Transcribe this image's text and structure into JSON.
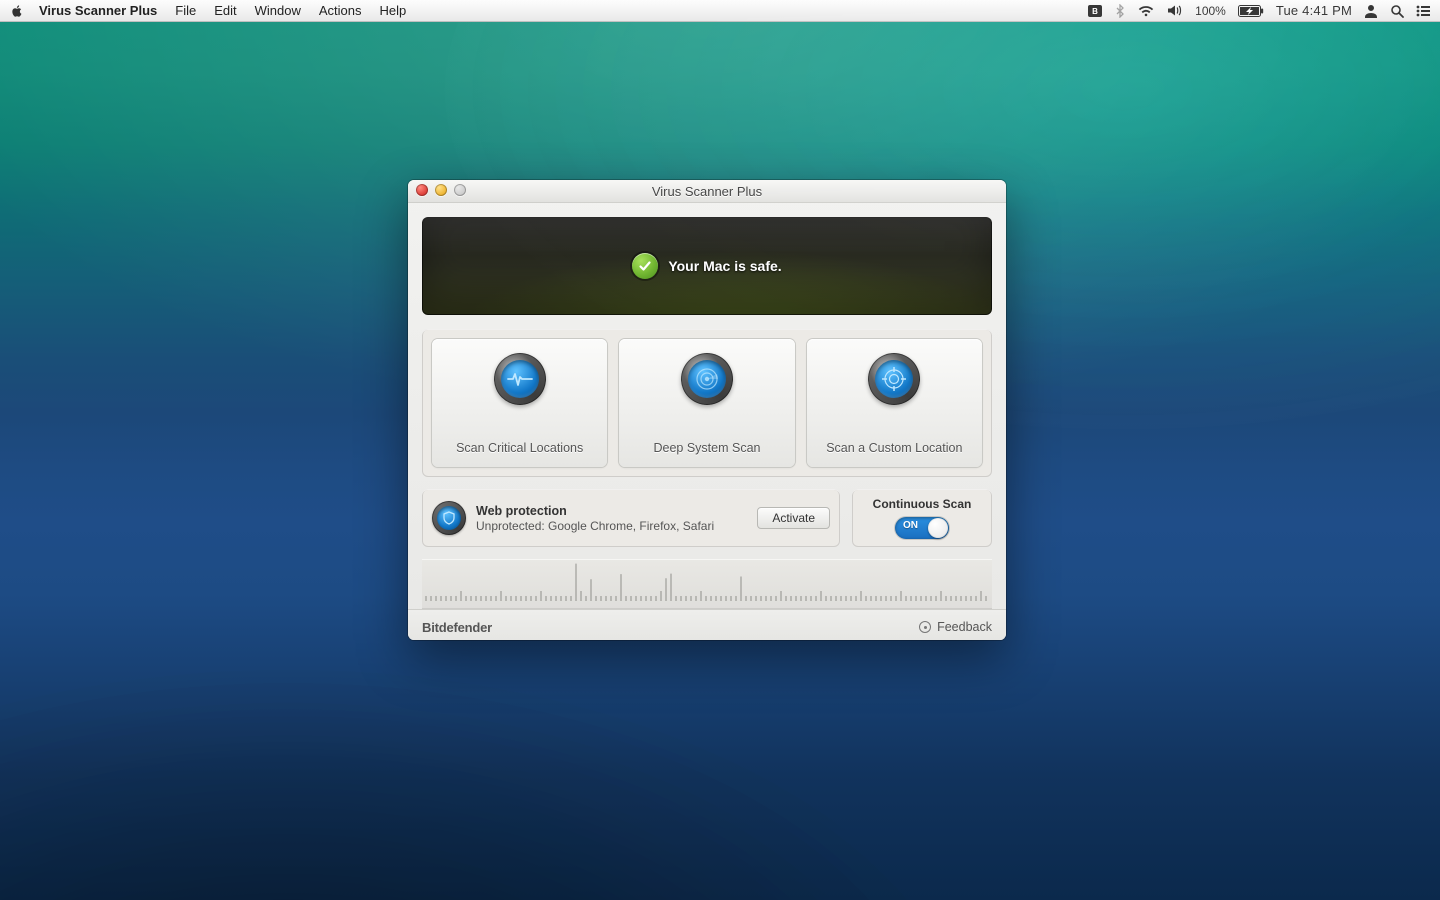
{
  "menubar": {
    "app_name": "Virus Scanner Plus",
    "items": [
      "File",
      "Edit",
      "Window",
      "Actions",
      "Help"
    ],
    "battery_percent": "100%",
    "clock": "Tue 4:41 PM"
  },
  "window": {
    "title": "Virus Scanner Plus",
    "status_message": "Your Mac is safe.",
    "scan_buttons": [
      {
        "label": "Scan Critical Locations",
        "icon": "pulse-icon"
      },
      {
        "label": "Deep System Scan",
        "icon": "radar-icon"
      },
      {
        "label": "Scan a Custom Location",
        "icon": "target-icon"
      }
    ],
    "web_protection": {
      "title": "Web protection",
      "subtitle": "Unprotected: Google Chrome, Firefox, Safari",
      "activate_label": "Activate"
    },
    "continuous_scan": {
      "title": "Continuous Scan",
      "state_label": "ON"
    },
    "brand": "Bitdefender",
    "feedback_label": "Feedback"
  }
}
